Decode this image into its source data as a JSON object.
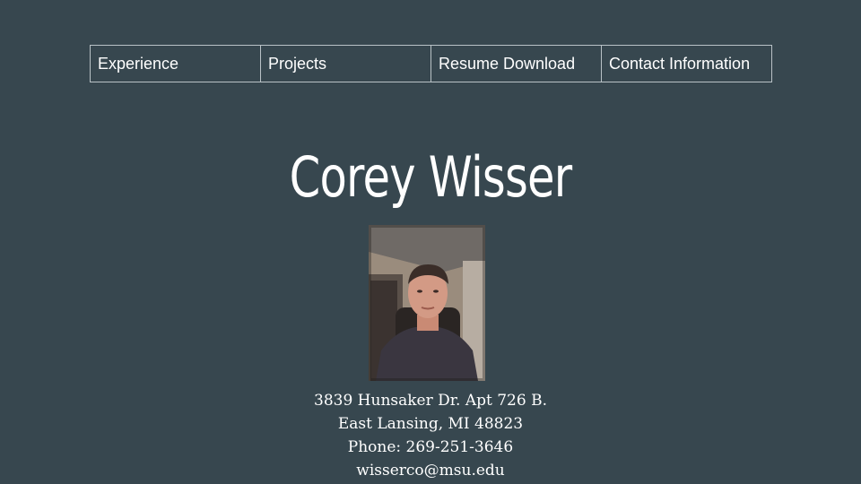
{
  "nav": {
    "items": [
      {
        "label": "Experience"
      },
      {
        "label": "Projects"
      },
      {
        "label": "Resume Download"
      },
      {
        "label": "Contact Information"
      }
    ]
  },
  "profile": {
    "name": "Corey Wisser",
    "address_line1": "3839 Hunsaker Dr. Apt 726 B.",
    "address_line2": "East Lansing, MI 48823",
    "phone": "Phone: 269-251-3646",
    "email": "wisserco@msu.edu"
  },
  "colors": {
    "background": "#37474f",
    "text": "#ffffff",
    "nav_border": "#b9c2c6"
  }
}
